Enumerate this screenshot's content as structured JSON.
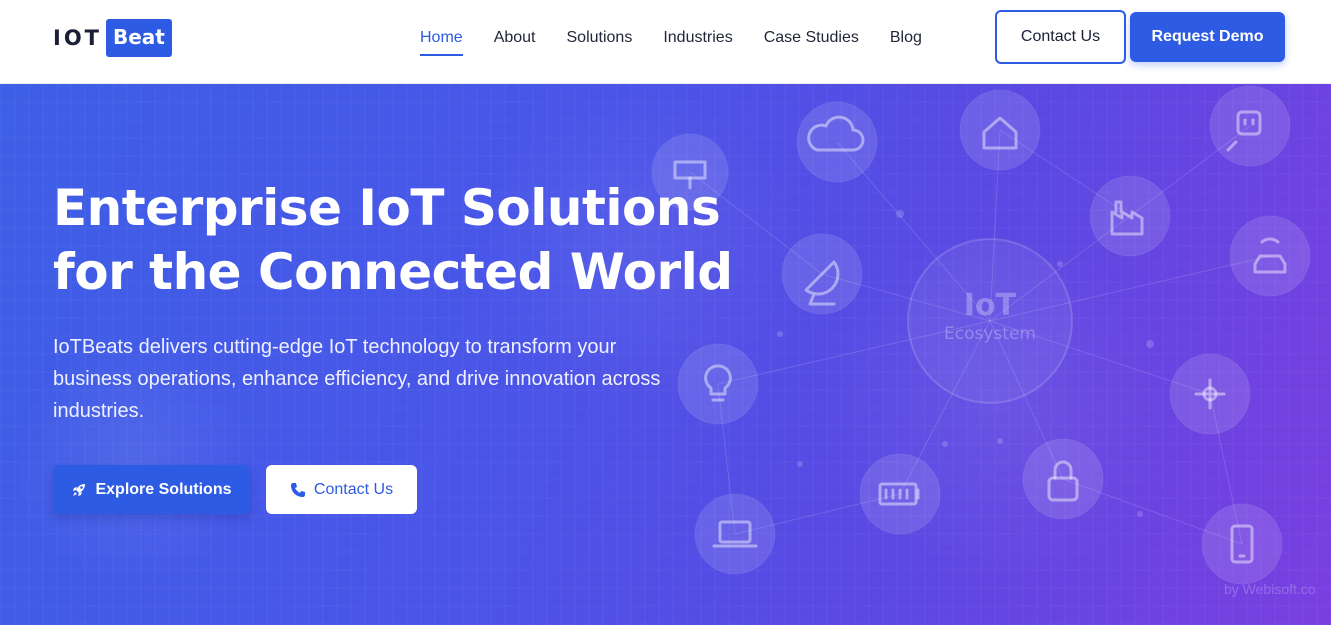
{
  "header": {
    "logo": {
      "left": "IOT",
      "right": "Beat"
    },
    "nav": [
      {
        "label": "Home",
        "active": true
      },
      {
        "label": "About"
      },
      {
        "label": "Solutions"
      },
      {
        "label": "Industries"
      },
      {
        "label": "Case Studies"
      },
      {
        "label": "Blog"
      }
    ],
    "contact_label": "Contact Us",
    "demo_label": "Request Demo"
  },
  "hero": {
    "title": "Enterprise IoT Solutions for the Connected World",
    "description": "IoTBeats delivers cutting-edge IoT technology to transform your business operations, enhance efficiency, and drive innovation across industries.",
    "primary_button": {
      "label": "Explore Solutions",
      "icon": "rocket-icon"
    },
    "secondary_button": {
      "label": "Contact Us",
      "icon": "phone-icon"
    },
    "ecosystem": {
      "title": "IoT",
      "subtitle": "Ecosystem"
    },
    "watermark": "by Webisoft.co"
  },
  "colors": {
    "accent": "#2d5be3",
    "hero_gradient_start": "#3d5fe6",
    "hero_gradient_end": "#7a3fe0",
    "text_dark": "#1a1f36"
  },
  "icons": [
    "cloud-check-icon",
    "house-icon",
    "smart-plug-icon",
    "solar-panel-icon",
    "factory-icon",
    "connected-car-icon",
    "satellite-dish-icon",
    "lightbulb-icon",
    "drone-icon",
    "battery-icon",
    "lock-icon",
    "laptop-icon",
    "smartphone-icon"
  ]
}
